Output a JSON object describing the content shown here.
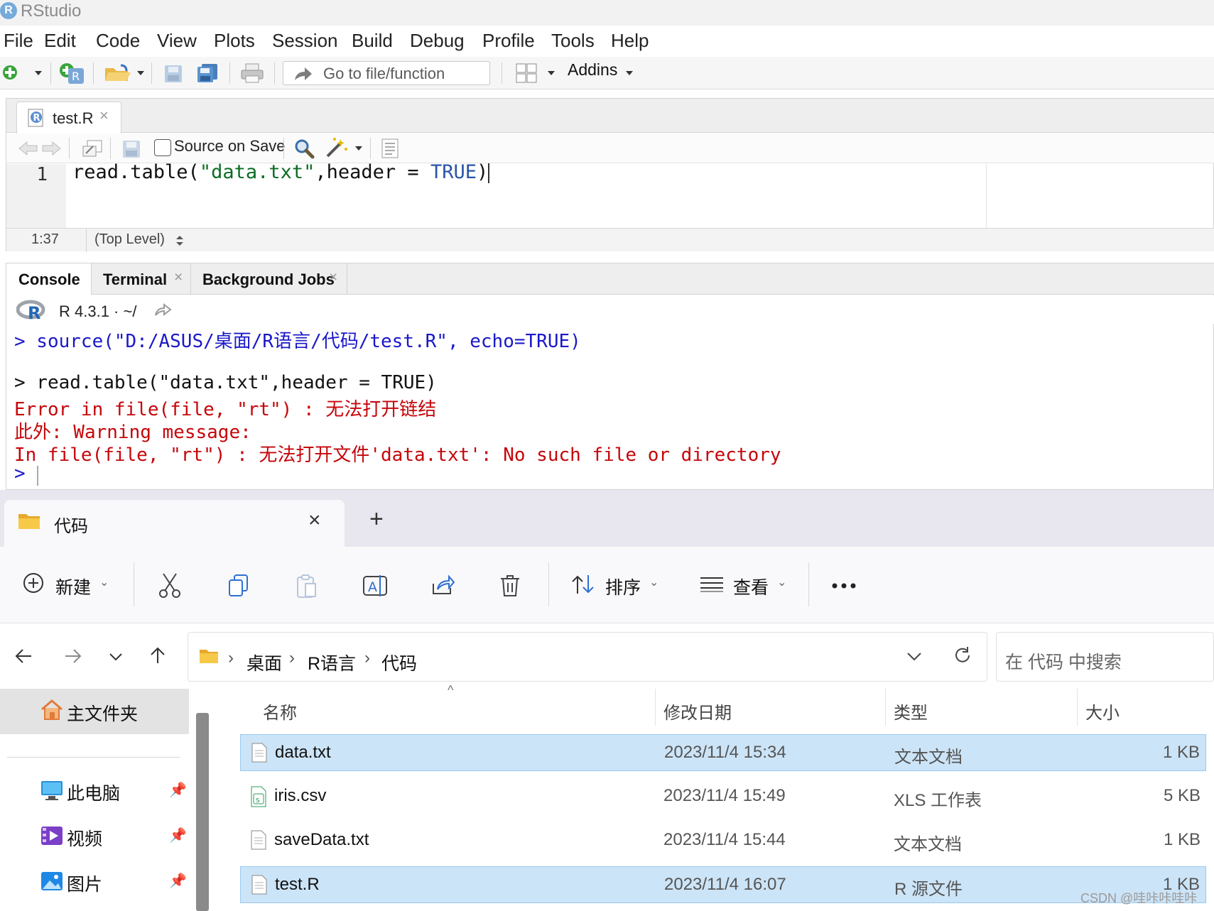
{
  "app_title": "RStudio",
  "menu": [
    "File",
    "Edit",
    "Code",
    "View",
    "Plots",
    "Session",
    "Build",
    "Debug",
    "Profile",
    "Tools",
    "Help"
  ],
  "toolbar": {
    "goto_placeholder": "Go to file/function",
    "addins_label": "Addins"
  },
  "editor": {
    "tab_label": "test.R",
    "source_on_save_label": "Source on Save",
    "source_on_save_checked": false,
    "line_number": "1",
    "code": {
      "fn": "read.table(",
      "str": "\"data.txt\"",
      "mid": ",header = ",
      "val": "TRUE",
      "end": ")"
    },
    "cursor_position": "1:37",
    "scope": "(Top Level)"
  },
  "console": {
    "tabs": [
      {
        "label": "Console"
      },
      {
        "label": "Terminal"
      },
      {
        "label": "Background Jobs"
      }
    ],
    "r_version": "R 4.3.1",
    "working_dir": "~/",
    "lines": [
      {
        "text": "> source(\"D:/ASUS/桌面/R语言/代码/test.R\", echo=TRUE)",
        "kind": "input"
      },
      {
        "text": "",
        "kind": "blank"
      },
      {
        "text": "> read.table(\"data.txt\",header = TRUE)",
        "kind": "echo"
      },
      {
        "text": "Error in file(file, \"rt\") : 无法打开链结",
        "kind": "error"
      },
      {
        "text": "此外: Warning message:",
        "kind": "error"
      },
      {
        "text": "In file(file, \"rt\") : 无法打开文件'data.txt': No such file or directory",
        "kind": "error"
      },
      {
        "text": ">",
        "kind": "input"
      }
    ],
    "colors": {
      "input": "#1a18c9",
      "echo": "#111111",
      "error": "#c5060b"
    }
  },
  "explorer": {
    "tab_label": "代码",
    "new_tab_symbol": "+",
    "commands": {
      "new_label": "新建",
      "sort_label": "排序",
      "view_label": "查看"
    },
    "breadcrumb": [
      "桌面",
      "R语言",
      "代码"
    ],
    "search_placeholder": "在 代码 中搜索",
    "nav": {
      "home": "主文件夹",
      "items": [
        {
          "label": "此电脑",
          "icon": "computer-icon"
        },
        {
          "label": "视频",
          "icon": "video-folder-icon"
        },
        {
          "label": "图片",
          "icon": "pictures-folder-icon"
        }
      ]
    },
    "columns": [
      "名称",
      "修改日期",
      "类型",
      "大小"
    ],
    "files": [
      {
        "name": "data.txt",
        "modified": "2023/11/4 15:34",
        "type": "文本文档",
        "size": "1 KB",
        "selected": true,
        "icon": "text-file-icon"
      },
      {
        "name": "iris.csv",
        "modified": "2023/11/4 15:49",
        "type": "XLS 工作表",
        "size": "5 KB",
        "selected": false,
        "icon": "spreadsheet-file-icon"
      },
      {
        "name": "saveData.txt",
        "modified": "2023/11/4 15:44",
        "type": "文本文档",
        "size": "1 KB",
        "selected": false,
        "icon": "text-file-icon"
      },
      {
        "name": "test.R",
        "modified": "2023/11/4 16:07",
        "type": "R 源文件",
        "size": "1 KB",
        "selected": true,
        "icon": "text-file-icon"
      }
    ]
  },
  "watermark": "CSDN @哇咔咔哇咔"
}
